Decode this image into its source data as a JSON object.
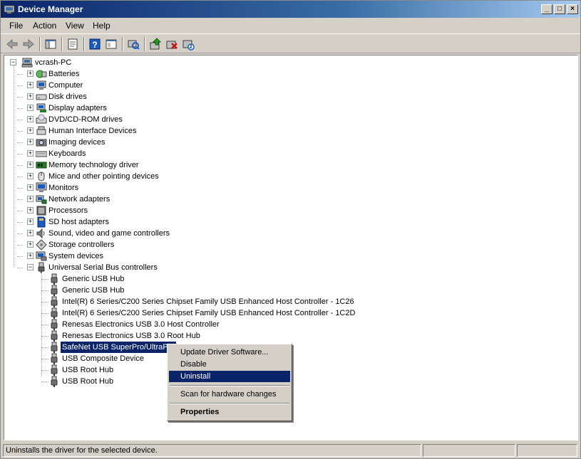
{
  "window": {
    "title": "Device Manager"
  },
  "menu": [
    "File",
    "Action",
    "View",
    "Help"
  ],
  "toolbar": [
    "back-arrow-icon",
    "forward-arrow-icon",
    "show-hide-console-tree-icon",
    "properties-icon",
    "help-icon",
    "console-view-icon",
    "scan-hardware-icon",
    "update-driver-icon",
    "uninstall-icon",
    "disable-icon"
  ],
  "tree": {
    "root": "vcrash-PC",
    "categories": [
      {
        "label": "Batteries",
        "icon": "battery-icon"
      },
      {
        "label": "Computer",
        "icon": "computer-icon"
      },
      {
        "label": "Disk drives",
        "icon": "disk-drive-icon"
      },
      {
        "label": "Display adapters",
        "icon": "display-adapter-icon"
      },
      {
        "label": "DVD/CD-ROM drives",
        "icon": "dvd-drive-icon"
      },
      {
        "label": "Human Interface Devices",
        "icon": "hid-icon"
      },
      {
        "label": "Imaging devices",
        "icon": "camera-icon"
      },
      {
        "label": "Keyboards",
        "icon": "keyboard-icon"
      },
      {
        "label": "Memory technology driver",
        "icon": "memory-icon"
      },
      {
        "label": "Mice and other pointing devices",
        "icon": "mouse-icon"
      },
      {
        "label": "Monitors",
        "icon": "monitor-icon"
      },
      {
        "label": "Network adapters",
        "icon": "network-adapter-icon"
      },
      {
        "label": "Processors",
        "icon": "processor-icon"
      },
      {
        "label": "SD host adapters",
        "icon": "sd-card-icon"
      },
      {
        "label": "Sound, video and game controllers",
        "icon": "speaker-icon"
      },
      {
        "label": "Storage controllers",
        "icon": "storage-controller-icon"
      },
      {
        "label": "System devices",
        "icon": "system-device-icon"
      },
      {
        "label": "Universal Serial Bus controllers",
        "icon": "usb-icon",
        "expanded": true
      }
    ],
    "usb_children": [
      "Generic USB Hub",
      "Generic USB Hub",
      "Intel(R) 6 Series/C200 Series Chipset Family USB Enhanced Host Controller - 1C26",
      "Intel(R) 6 Series/C200 Series Chipset Family USB Enhanced Host Controller - 1C2D",
      "Renesas Electronics USB 3.0 Host Controller",
      "Renesas Electronics USB 3.0 Root Hub",
      "SafeNet USB SuperPro/UltraPro",
      "USB Composite Device",
      "USB Root Hub",
      "USB Root Hub"
    ],
    "selected_child": "SafeNet USB SuperPro/UltraPro"
  },
  "context_menu": {
    "items": [
      {
        "label": "Update Driver Software...",
        "type": "item"
      },
      {
        "label": "Disable",
        "type": "item"
      },
      {
        "label": "Uninstall",
        "type": "item",
        "highlighted": true
      },
      {
        "type": "separator"
      },
      {
        "label": "Scan for hardware changes",
        "type": "item"
      },
      {
        "type": "separator"
      },
      {
        "label": "Properties",
        "type": "item",
        "bold": true
      }
    ]
  },
  "status": {
    "text": "Uninstalls the driver for the selected device."
  },
  "colors": {
    "selection": "#0a246a",
    "titlebar_start": "#0a246a",
    "titlebar_end": "#a6caf0",
    "face": "#d4d0c8"
  }
}
